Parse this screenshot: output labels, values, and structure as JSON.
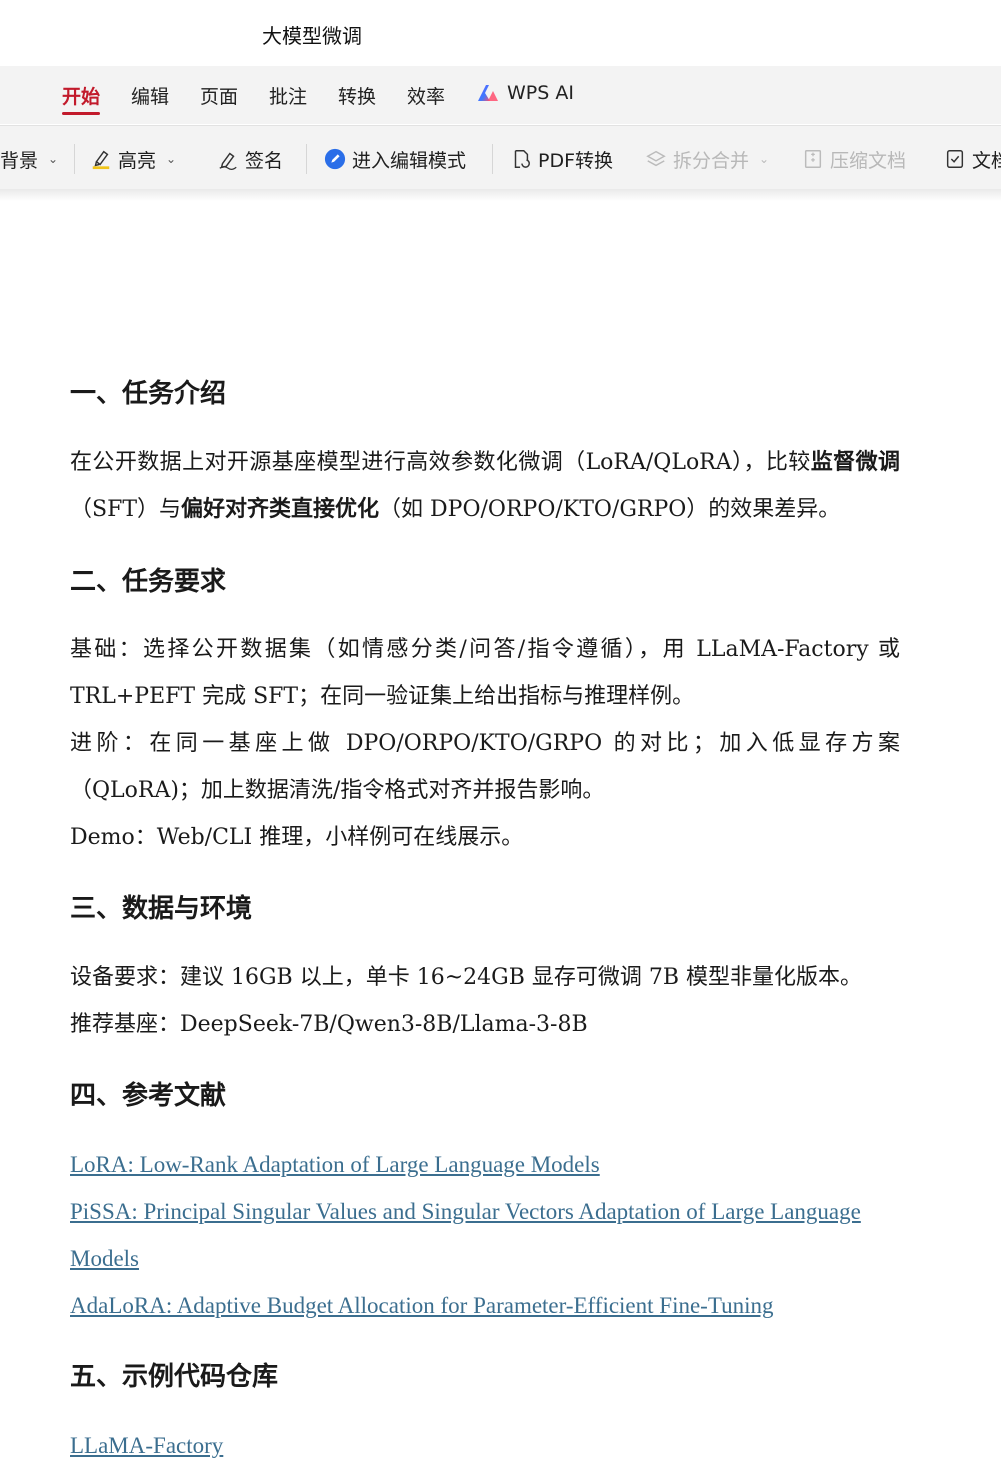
{
  "window": {
    "title": "大模型微调"
  },
  "menu": {
    "items": [
      "开始",
      "编辑",
      "页面",
      "批注",
      "转换",
      "效率"
    ],
    "ai_label": "WPS AI",
    "active": "开始"
  },
  "toolbar": {
    "background": "背景",
    "highlight": "高亮",
    "sign": "签名",
    "edit_mode": "进入编辑模式",
    "pdf_convert": "PDF转换",
    "split_merge": "拆分合并",
    "compress": "压缩文档",
    "doc": "文档"
  },
  "colors": {
    "accent": "#c21a2b",
    "link": "#3b6e8f",
    "edit_icon": "#2a6ee8"
  },
  "doc": {
    "s1": {
      "heading": "一、任务介绍",
      "p1a": "在公开数据上对开源基座模型进行高效参数化微调（LoRA/QLoRA），比较",
      "p1b": "监督微调",
      "p1c": "（SFT）与",
      "p1d": "偏好对齐类直接优化",
      "p1e": "（如 DPO/ORPO/KTO/GRPO）的效果差异。"
    },
    "s2": {
      "heading": "二、任务要求",
      "basic": "基础：选择公开数据集（如情感分类/问答/指令遵循），用 LLaMA-Factory 或 TRL+PEFT 完成 SFT；在同一验证集上给出指标与推理样例。",
      "advanced": "进阶：在同一基座上做 DPO/ORPO/KTO/GRPO 的对比；加入低显存方案（QLoRA)；加上数据清洗/指令格式对齐并报告影响。",
      "demo": "Demo：Web/CLI 推理，小样例可在线展示。"
    },
    "s3": {
      "heading": "三、数据与环境",
      "device": "设备要求：建议 16GB 以上，单卡 16~24GB 显存可微调 7B 模型非量化版本。",
      "base": "推荐基座：DeepSeek-7B/Qwen3-8B/Llama-3-8B"
    },
    "s4": {
      "heading": "四、参考文献",
      "refs": [
        "LoRA: Low-Rank Adaptation of Large Language Models",
        "PiSSA: Principal Singular Values and Singular Vectors Adaptation of Large Language",
        "Models",
        "AdaLoRA: Adaptive Budget Allocation for Parameter-Efficient Fine-Tuning"
      ]
    },
    "s5": {
      "heading": "五、示例代码仓库",
      "repos": [
        "LLaMA-Factory"
      ]
    }
  }
}
